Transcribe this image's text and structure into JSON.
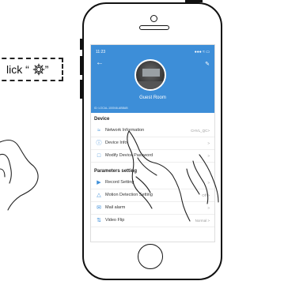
{
  "callout": {
    "text": "lick “",
    "close_quote": "”"
  },
  "status_bar": {
    "time": "11:23",
    "icons": "●●● ≈ ▭"
  },
  "camera": {
    "name": "Guest Room",
    "id": "ID: LOCAL-100046-ABBAB"
  },
  "sections": {
    "device": "Device",
    "parameters": "Parameters setting"
  },
  "device_rows": [
    {
      "label": "Network Information",
      "value": "CHVL_QC>"
    },
    {
      "label": "Device Info",
      "value": ">"
    },
    {
      "label": "Modify Device Password",
      "value": ">"
    }
  ],
  "param_rows": [
    {
      "label": "Record Setting",
      "value": ">"
    },
    {
      "label": "Motion Detection Setting",
      "value": "Off >"
    },
    {
      "label": "Mail alarm",
      "value": ">"
    },
    {
      "label": "Video Flip",
      "value": "Normal >"
    }
  ],
  "icons": [
    "gear-icon",
    "wifi-icon",
    "info-icon",
    "lock-icon",
    "camera-icon",
    "bell-icon",
    "mail-icon",
    "flip-icon",
    "back-arrow-icon",
    "edit-icon"
  ]
}
